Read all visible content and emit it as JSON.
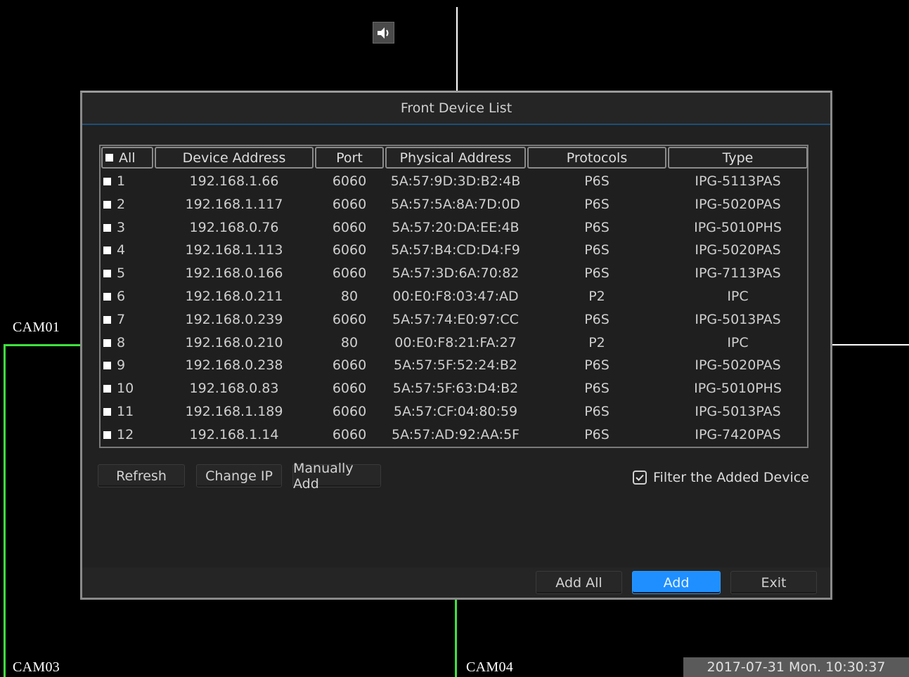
{
  "cameras": {
    "cam01": "CAM01",
    "cam03": "CAM03",
    "cam04": "CAM04"
  },
  "datetime": "2017-07-31 Mon. 10:30:37",
  "dialog": {
    "title": "Front Device List",
    "columns": {
      "all": "All",
      "device_address": "Device Address",
      "port": "Port",
      "physical_address": "Physical Address",
      "protocols": "Protocols",
      "type": "Type"
    },
    "rows": [
      {
        "idx": "1",
        "ip": "192.168.1.66",
        "port": "6060",
        "mac": "5A:57:9D:3D:B2:4B",
        "protocol": "P6S",
        "type": "IPG-5113PAS"
      },
      {
        "idx": "2",
        "ip": "192.168.1.117",
        "port": "6060",
        "mac": "5A:57:5A:8A:7D:0D",
        "protocol": "P6S",
        "type": "IPG-5020PAS"
      },
      {
        "idx": "3",
        "ip": "192.168.0.76",
        "port": "6060",
        "mac": "5A:57:20:DA:EE:4B",
        "protocol": "P6S",
        "type": "IPG-5010PHS"
      },
      {
        "idx": "4",
        "ip": "192.168.1.113",
        "port": "6060",
        "mac": "5A:57:B4:CD:D4:F9",
        "protocol": "P6S",
        "type": "IPG-5020PAS"
      },
      {
        "idx": "5",
        "ip": "192.168.0.166",
        "port": "6060",
        "mac": "5A:57:3D:6A:70:82",
        "protocol": "P6S",
        "type": "IPG-7113PAS"
      },
      {
        "idx": "6",
        "ip": "192.168.0.211",
        "port": "80",
        "mac": "00:E0:F8:03:47:AD",
        "protocol": "P2",
        "type": "IPC"
      },
      {
        "idx": "7",
        "ip": "192.168.0.239",
        "port": "6060",
        "mac": "5A:57:74:E0:97:CC",
        "protocol": "P6S",
        "type": "IPG-5013PAS"
      },
      {
        "idx": "8",
        "ip": "192.168.0.210",
        "port": "80",
        "mac": "00:E0:F8:21:FA:27",
        "protocol": "P2",
        "type": "IPC"
      },
      {
        "idx": "9",
        "ip": "192.168.0.238",
        "port": "6060",
        "mac": "5A:57:5F:52:24:B2",
        "protocol": "P6S",
        "type": "IPG-5020PAS"
      },
      {
        "idx": "10",
        "ip": "192.168.0.83",
        "port": "6060",
        "mac": "5A:57:5F:63:D4:B2",
        "protocol": "P6S",
        "type": "IPG-5010PHS"
      },
      {
        "idx": "11",
        "ip": "192.168.1.189",
        "port": "6060",
        "mac": "5A:57:CF:04:80:59",
        "protocol": "P6S",
        "type": "IPG-5013PAS"
      },
      {
        "idx": "12",
        "ip": "192.168.1.14",
        "port": "6060",
        "mac": "5A:57:AD:92:AA:5F",
        "protocol": "P6S",
        "type": "IPG-7420PAS"
      }
    ],
    "buttons": {
      "refresh": "Refresh",
      "change_ip": "Change IP",
      "manually_add": "Manually Add",
      "add_all": "Add All",
      "add": "Add",
      "exit": "Exit"
    },
    "filter_label": "Filter the Added Device",
    "filter_checked": true
  },
  "colors": {
    "accent": "#1f8fff",
    "selected_border": "#3fe23f"
  },
  "icons": {
    "speaker": "speaker-icon"
  }
}
